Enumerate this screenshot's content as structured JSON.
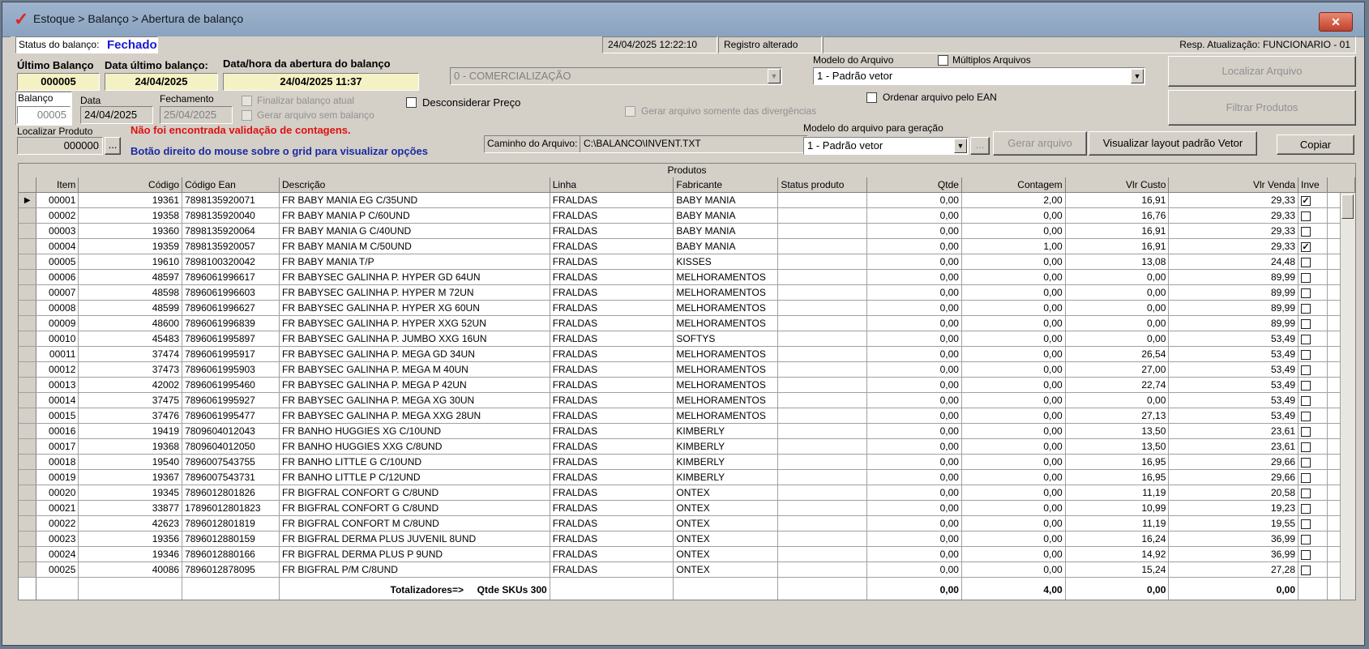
{
  "window": {
    "title": "Estoque > Balanço > Abertura de balanço"
  },
  "status": {
    "label": "Status do balanço:",
    "value": "Fechado",
    "datetime": "24/04/2025 12:22:10",
    "registro": "Registro alterado",
    "resp": "Resp. Atualização: FUNCIONARIO - 01"
  },
  "header": {
    "ultimo_balanco_label": "Último Balanço",
    "ultimo_balanco_value": "000005",
    "data_ultimo_label": "Data último balanço:",
    "data_ultimo_value": "24/04/2025",
    "abertura_label": "Data/hora da abertura do balanço",
    "abertura_value": "24/04/2025 11:37",
    "comercializacao": "0 - COMERCIALIZAÇÃO",
    "modelo_arquivo_label": "Modelo do Arquivo",
    "modelo_arquivo_value": "1 - Padrão vetor",
    "multiplos_label": "Múltiplos Arquivos",
    "localizar_arquivo": "Localizar Arquivo",
    "filtrar_produtos": "Filtrar Produtos"
  },
  "form": {
    "balanco_label": "Balanço",
    "balanco_value": "00005",
    "data_label": "Data",
    "data_value": "24/04/2025",
    "fechamento_label": "Fechamento",
    "fechamento_value": "25/04/2025",
    "finalizar_label": "Finalizar balanço atual",
    "gerar_sem_label": "Gerar arquivo sem balanço",
    "desconsiderar_label": "Desconsiderar Preço",
    "gerar_divergencias_label": "Gerar arquivo somente das divergências",
    "ordenar_ean_label": "Ordenar arquivo pelo EAN",
    "localizar_produto_label": "Localizar Produto",
    "localizar_produto_value": "000000",
    "ellipsis": "...",
    "msg_erro": "Não foi encontrada validação de contagens.",
    "msg_info": "Botão direito do mouse sobre o grid para visualizar opções",
    "caminho_label": "Caminho do Arquivo:",
    "caminho_value": "C:\\BALANCO\\INVENT.TXT",
    "modelo_geracao_label": "Modelo do arquivo para geração",
    "modelo_geracao_value": "1 - Padrão vetor",
    "gerar_arquivo": "Gerar arquivo",
    "visualizar_layout": "Visualizar layout padrão Vetor",
    "copiar": "Copiar"
  },
  "grid": {
    "caption": "Produtos",
    "columns": [
      "Item",
      "Código",
      "Código Ean",
      "Descrição",
      "Linha",
      "Fabricante",
      "Status produto",
      "Qtde",
      "Contagem",
      "Vlr Custo",
      "Vlr Venda",
      "Inve"
    ],
    "rows": [
      [
        "00001",
        "19361",
        "7898135920071",
        "FR BABY MANIA  EG C/35UND",
        "FRALDAS",
        "BABY MANIA",
        "",
        "0,00",
        "2,00",
        "16,91",
        "29,33",
        true
      ],
      [
        "00002",
        "19358",
        "7898135920040",
        "FR BABY MANIA  P C/60UND",
        "FRALDAS",
        "BABY MANIA",
        "",
        "0,00",
        "0,00",
        "16,76",
        "29,33",
        false
      ],
      [
        "00003",
        "19360",
        "7898135920064",
        "FR BABY MANIA G C/40UND",
        "FRALDAS",
        "BABY MANIA",
        "",
        "0,00",
        "0,00",
        "16,91",
        "29,33",
        false
      ],
      [
        "00004",
        "19359",
        "7898135920057",
        "FR BABY MANIA M C/50UND",
        "FRALDAS",
        "BABY MANIA",
        "",
        "0,00",
        "1,00",
        "16,91",
        "29,33",
        true
      ],
      [
        "00005",
        "19610",
        "7898100320042",
        "FR BABY MANIA T/P",
        "FRALDAS",
        "KISSES",
        "",
        "0,00",
        "0,00",
        "13,08",
        "24,48",
        false
      ],
      [
        "00006",
        "48597",
        "7896061996617",
        "FR BABYSEC GALINHA P. HYPER GD 64UN",
        "FRALDAS",
        "MELHORAMENTOS",
        "",
        "0,00",
        "0,00",
        "0,00",
        "89,99",
        false
      ],
      [
        "00007",
        "48598",
        "7896061996603",
        "FR BABYSEC GALINHA P. HYPER M 72UN",
        "FRALDAS",
        "MELHORAMENTOS",
        "",
        "0,00",
        "0,00",
        "0,00",
        "89,99",
        false
      ],
      [
        "00008",
        "48599",
        "7896061996627",
        "FR BABYSEC GALINHA P. HYPER XG 60UN",
        "FRALDAS",
        "MELHORAMENTOS",
        "",
        "0,00",
        "0,00",
        "0,00",
        "89,99",
        false
      ],
      [
        "00009",
        "48600",
        "7896061996839",
        "FR BABYSEC GALINHA P. HYPER XXG 52UN",
        "FRALDAS",
        "MELHORAMENTOS",
        "",
        "0,00",
        "0,00",
        "0,00",
        "89,99",
        false
      ],
      [
        "00010",
        "45483",
        "7896061995897",
        "FR BABYSEC GALINHA P. JUMBO XXG 16UN",
        "FRALDAS",
        "SOFTYS",
        "",
        "0,00",
        "0,00",
        "0,00",
        "53,49",
        false
      ],
      [
        "00011",
        "37474",
        "7896061995917",
        "FR BABYSEC GALINHA P. MEGA GD 34UN",
        "FRALDAS",
        "MELHORAMENTOS",
        "",
        "0,00",
        "0,00",
        "26,54",
        "53,49",
        false
      ],
      [
        "00012",
        "37473",
        "7896061995903",
        "FR BABYSEC GALINHA P. MEGA M 40UN",
        "FRALDAS",
        "MELHORAMENTOS",
        "",
        "0,00",
        "0,00",
        "27,00",
        "53,49",
        false
      ],
      [
        "00013",
        "42002",
        "7896061995460",
        "FR BABYSEC GALINHA P. MEGA P 42UN",
        "FRALDAS",
        "MELHORAMENTOS",
        "",
        "0,00",
        "0,00",
        "22,74",
        "53,49",
        false
      ],
      [
        "00014",
        "37475",
        "7896061995927",
        "FR BABYSEC GALINHA P. MEGA XG 30UN",
        "FRALDAS",
        "MELHORAMENTOS",
        "",
        "0,00",
        "0,00",
        "0,00",
        "53,49",
        false
      ],
      [
        "00015",
        "37476",
        "7896061995477",
        "FR BABYSEC GALINHA P. MEGA XXG 28UN",
        "FRALDAS",
        "MELHORAMENTOS",
        "",
        "0,00",
        "0,00",
        "27,13",
        "53,49",
        false
      ],
      [
        "00016",
        "19419",
        "7809604012043",
        "FR BANHO HUGGIES XG C/10UND",
        "FRALDAS",
        "KIMBERLY",
        "",
        "0,00",
        "0,00",
        "13,50",
        "23,61",
        false
      ],
      [
        "00017",
        "19368",
        "7809604012050",
        "FR BANHO HUGGIES XXG C/8UND",
        "FRALDAS",
        "KIMBERLY",
        "",
        "0,00",
        "0,00",
        "13,50",
        "23,61",
        false
      ],
      [
        "00018",
        "19540",
        "7896007543755",
        "FR BANHO LITTLE G C/10UND",
        "FRALDAS",
        "KIMBERLY",
        "",
        "0,00",
        "0,00",
        "16,95",
        "29,66",
        false
      ],
      [
        "00019",
        "19367",
        "7896007543731",
        "FR BANHO LITTLE P C/12UND",
        "FRALDAS",
        "KIMBERLY",
        "",
        "0,00",
        "0,00",
        "16,95",
        "29,66",
        false
      ],
      [
        "00020",
        "19345",
        "7896012801826",
        "FR BIGFRAL CONFORT G C/8UND",
        "FRALDAS",
        "ONTEX",
        "",
        "0,00",
        "0,00",
        "11,19",
        "20,58",
        false
      ],
      [
        "00021",
        "33877",
        "17896012801823",
        "FR BIGFRAL CONFORT G C/8UND",
        "FRALDAS",
        "ONTEX",
        "",
        "0,00",
        "0,00",
        "10,99",
        "19,23",
        false
      ],
      [
        "00022",
        "42623",
        "7896012801819",
        "FR BIGFRAL CONFORT M C/8UND",
        "FRALDAS",
        "ONTEX",
        "",
        "0,00",
        "0,00",
        "11,19",
        "19,55",
        false
      ],
      [
        "00023",
        "19356",
        "7896012880159",
        "FR BIGFRAL DERMA PLUS JUVENIL 8UND",
        "FRALDAS",
        "ONTEX",
        "",
        "0,00",
        "0,00",
        "16,24",
        "36,99",
        false
      ],
      [
        "00024",
        "19346",
        "7896012880166",
        "FR BIGFRAL DERMA PLUS P 9UND",
        "FRALDAS",
        "ONTEX",
        "",
        "0,00",
        "0,00",
        "14,92",
        "36,99",
        false
      ],
      [
        "00025",
        "40086",
        "7896012878095",
        "FR BIGFRAL P/M C/8UND",
        "FRALDAS",
        "ONTEX",
        "",
        "0,00",
        "0,00",
        "15,24",
        "27,28",
        false
      ]
    ],
    "totals": {
      "label": "Totalizadores=>",
      "skus": "Qtde SKUs 300",
      "qtde": "0,00",
      "contagem": "4,00",
      "custo": "0,00",
      "venda": "0,00"
    }
  },
  "colors": {
    "title_bar": "#8aa3c0",
    "status_blue": "#1a1ad0",
    "error_red": "#e01010",
    "info_blue": "#1a2aa0",
    "highlight_yellow": "#f4f1c4"
  },
  "icons": {
    "logo": "check-logo-icon",
    "close": "close-icon",
    "row_pointer": "row-pointer-icon"
  }
}
